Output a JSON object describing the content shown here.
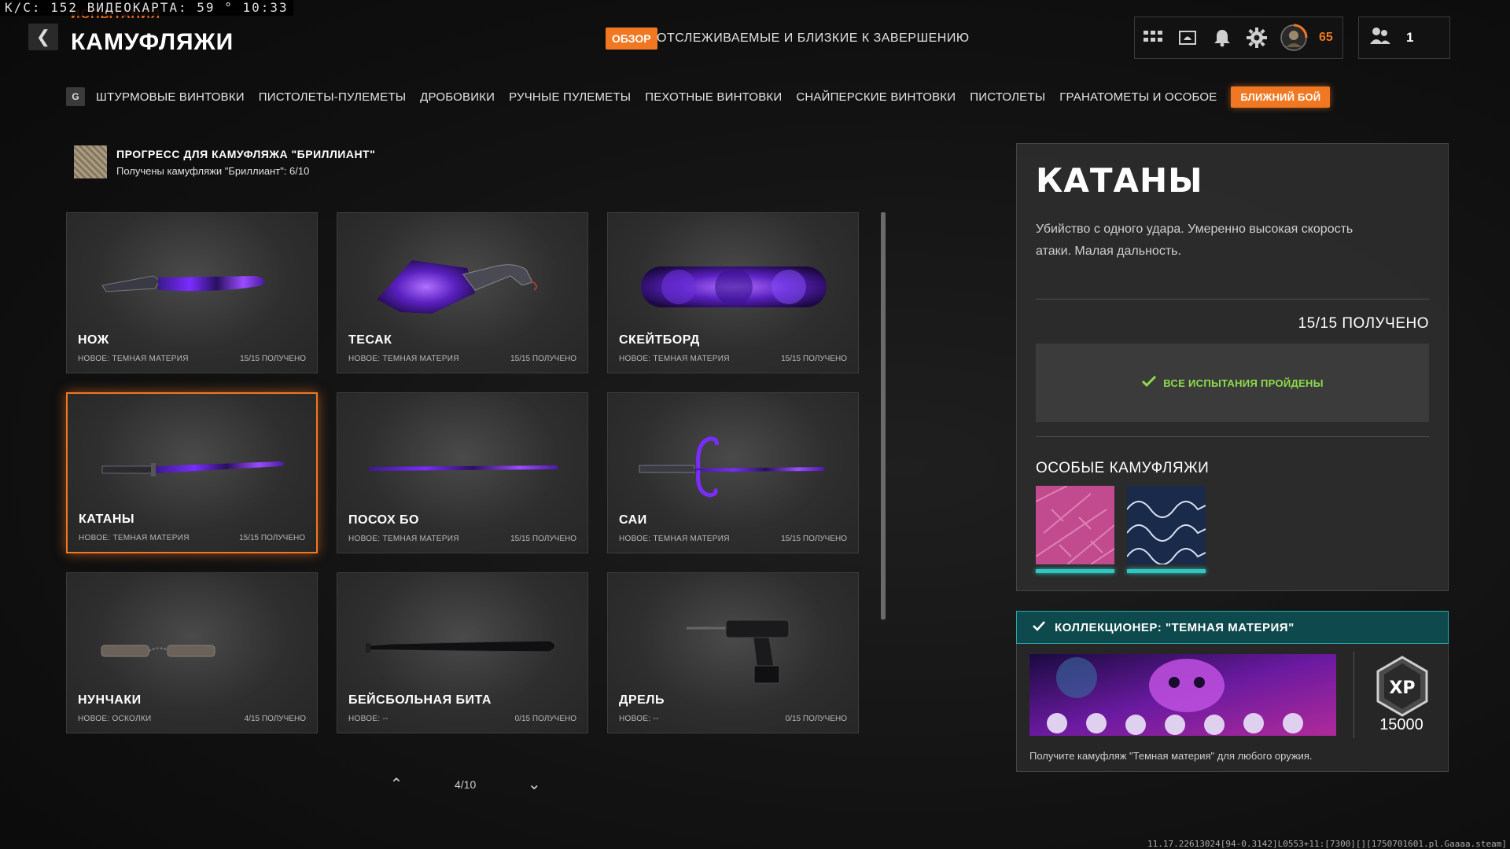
{
  "overlay": {
    "fps_text": "К/С: 152 ВИДЕОКАРТА: 59 ° 10:33"
  },
  "header": {
    "breadcrumb": "ИСПЫТАНИЯ",
    "title": "КАМУФЛЯЖИ",
    "overview_badge": "ОБЗОР",
    "tracked_label": "ОТСЛЕЖИВАЕМЫЕ И БЛИЗКИЕ К ЗАВЕРШЕНИЮ",
    "level": "65",
    "friends_count": "1"
  },
  "tabs": {
    "key_hint": "G",
    "items": [
      {
        "label": "ШТУРМОВЫЕ ВИНТОВКИ"
      },
      {
        "label": "ПИСТОЛЕТЫ-ПУЛЕМЕТЫ"
      },
      {
        "label": "ДРОБОВИКИ"
      },
      {
        "label": "РУЧНЫЕ ПУЛЕМЕТЫ"
      },
      {
        "label": "ПЕХОТНЫЕ ВИНТОВКИ"
      },
      {
        "label": "СНАЙПЕРСКИЕ ВИНТОВКИ"
      },
      {
        "label": "ПИСТОЛЕТЫ"
      },
      {
        "label": "ГРАНАТОМЕТЫ И ОСОБОЕ"
      },
      {
        "label": "БЛИЖНИЙ БОЙ",
        "active": true
      }
    ]
  },
  "progress": {
    "title": "ПРОГРЕСС ДЛЯ КАМУФЛЯЖА \"БРИЛЛИАНТ\"",
    "subtitle": "Получены камуфляжи \"Бриллиант\": 6/10"
  },
  "weapons": [
    {
      "name": "НОЖ",
      "new_camo": "НОВОЕ: ТЕМНАЯ МАТЕРИЯ",
      "count": "15/15 ПОЛУЧЕНО",
      "icon": "knife-icon"
    },
    {
      "name": "ТЕСАК",
      "new_camo": "НОВОЕ: ТЕМНАЯ МАТЕРИЯ",
      "count": "15/15 ПОЛУЧЕНО",
      "icon": "cleaver-icon"
    },
    {
      "name": "СКЕЙТБОРД",
      "new_camo": "НОВОЕ: ТЕМНАЯ МАТЕРИЯ",
      "count": "15/15 ПОЛУЧЕНО",
      "icon": "skateboard-icon"
    },
    {
      "name": "КАТАНЫ",
      "new_camo": "НОВОЕ: ТЕМНАЯ МАТЕРИЯ",
      "count": "15/15 ПОЛУЧЕНО",
      "icon": "katana-icon",
      "selected": true
    },
    {
      "name": "ПОСОХ БО",
      "new_camo": "НОВОЕ: ТЕМНАЯ МАТЕРИЯ",
      "count": "15/15 ПОЛУЧЕНО",
      "icon": "bo-staff-icon"
    },
    {
      "name": "САИ",
      "new_camo": "НОВОЕ: ТЕМНАЯ МАТЕРИЯ",
      "count": "15/15 ПОЛУЧЕНО",
      "icon": "sai-icon"
    },
    {
      "name": "НУНЧАКИ",
      "new_camo": "НОВОЕ: ОСКОЛКИ",
      "count": "4/15 ПОЛУЧЕНО",
      "icon": "nunchaku-icon"
    },
    {
      "name": "БЕЙСБОЛЬНАЯ БИТА",
      "new_camo": "НОВОЕ: --",
      "count": "0/15 ПОЛУЧЕНО",
      "icon": "baseball-bat-icon"
    },
    {
      "name": "ДРЕЛЬ",
      "new_camo": "НОВОЕ: --",
      "count": "0/15 ПОЛУЧЕНО",
      "icon": "drill-icon"
    }
  ],
  "pager": {
    "page": "4/10"
  },
  "detail": {
    "title": "КАТАНЫ",
    "description": "Убийство с одного удара. Умеренно высокая скорость атаки. Малая дальность.",
    "completed_count": "15/15 ПОЛУЧЕНО",
    "all_done": "ВСЕ ИСПЫТАНИЯ ПРОЙДЕНЫ",
    "special_title": "ОСОБЫЕ КАМУФЛЯЖИ"
  },
  "collector": {
    "title": "КОЛЛЕКЦИОНЕР: \"ТЕМНАЯ МАТЕРИЯ\"",
    "xp": "15000",
    "description": "Получите камуфляж \"Темная материя\" для любого оружия."
  },
  "build": "11.17.22613024[94-0.3142]L0553+11:[7300][][1750701601.pl.Gaaaa.steam]",
  "colors": {
    "accent": "#f07822",
    "teal": "#2aa8a8",
    "success": "#8edc4a",
    "purple": "#7a2cff"
  }
}
